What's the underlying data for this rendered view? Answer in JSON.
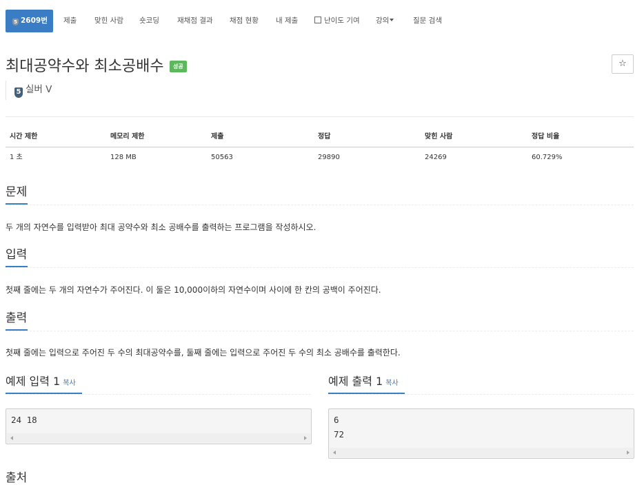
{
  "nav": {
    "problem_id": "2609번",
    "items": [
      "제출",
      "맞힌 사람",
      "숏코딩",
      "재채점 결과",
      "채점 현황",
      "내 제출",
      "난이도 기여",
      "강의",
      "질문 검색"
    ]
  },
  "problem": {
    "title": "최대공약수와 최소공배수",
    "status_badge": "성공",
    "star": "☆",
    "tier_number": "5",
    "tier": "실버 V"
  },
  "stats": {
    "headers": [
      "시간 제한",
      "메모리 제한",
      "제출",
      "정답",
      "맞힌 사람",
      "정답 비율"
    ],
    "values": [
      "1 초",
      "128 MB",
      "50563",
      "29890",
      "24269",
      "60.729%"
    ]
  },
  "sections": {
    "problem_title": "문제",
    "problem_text": "두 개의 자연수를 입력받아 최대 공약수와 최소 공배수를 출력하는 프로그램을 작성하시오.",
    "input_title": "입력",
    "input_text": "첫째 줄에는 두 개의 자연수가 주어진다. 이 둘은 10,000이하의 자연수이며 사이에 한 칸의 공백이 주어진다.",
    "output_title": "출력",
    "output_text": "첫째 줄에는 입력으로 주어진 두 수의 최대공약수를, 둘째 줄에는 입력으로 주어진 두 수의 최소 공배수를 출력한다.",
    "source_title": "출처"
  },
  "examples": {
    "input_title": "예제 입력 1",
    "output_title": "예제 출력 1",
    "copy_label": "복사",
    "input_lines": [
      "24 18"
    ],
    "output_lines": [
      "6",
      "72"
    ]
  },
  "colors": {
    "accent": "#3b7dc4",
    "success": "#5cb85c",
    "tier_silver": "#435f7a"
  }
}
